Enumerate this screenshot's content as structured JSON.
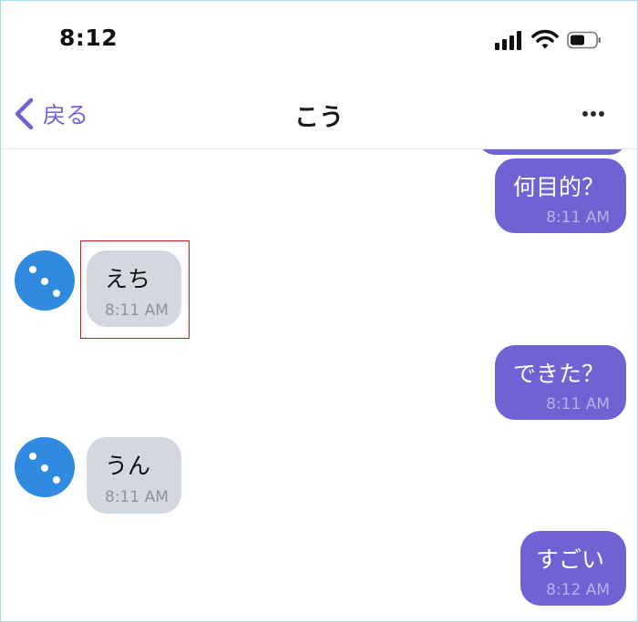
{
  "status_bar": {
    "time": "8:12"
  },
  "nav": {
    "back_label": "戻る",
    "title": "こう",
    "icons": {
      "back": "chevron-left-icon",
      "more": "more-horizontal-icon"
    }
  },
  "colors": {
    "accent": "#6f63d4",
    "outgoing_bubble": "#6f63d4",
    "incoming_bubble": "#d3d7df",
    "avatar": "#2f8ae0",
    "highlight_border": "#c91d1d"
  },
  "messages": [
    {
      "direction": "outgoing",
      "text": "何目的？",
      "time": "8:11 AM"
    },
    {
      "direction": "incoming",
      "text": "えち",
      "time": "8:11 AM",
      "highlighted": true
    },
    {
      "direction": "outgoing",
      "text": "できた？",
      "time": "8:11 AM"
    },
    {
      "direction": "incoming",
      "text": "うん",
      "time": "8:11 AM"
    },
    {
      "direction": "outgoing",
      "text": "すごい",
      "time": "8:12 AM"
    }
  ]
}
